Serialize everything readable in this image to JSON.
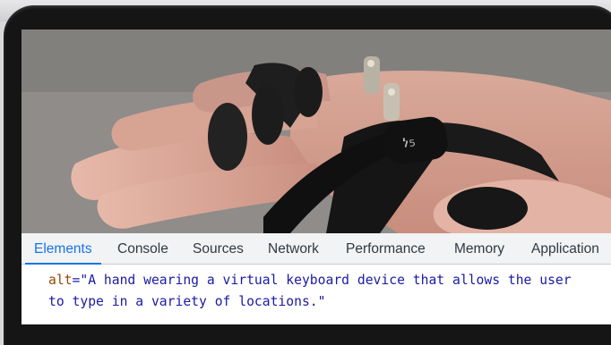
{
  "devtools": {
    "tabs": [
      "Elements",
      "Console",
      "Sources",
      "Network",
      "Performance",
      "Memory",
      "Application"
    ],
    "active_tab": "Elements"
  },
  "code": {
    "attr_name": "alt",
    "equals": "=",
    "line1": "\"A hand wearing a virtual keyboard device that allows the user",
    "line2": "to type in a variety of locations.\""
  },
  "colors": {
    "active_tab": "#1a73e8",
    "attr_name": "#994500",
    "attr_value": "#1a1aa6",
    "tabbar_bg": "#f1f3f4"
  }
}
